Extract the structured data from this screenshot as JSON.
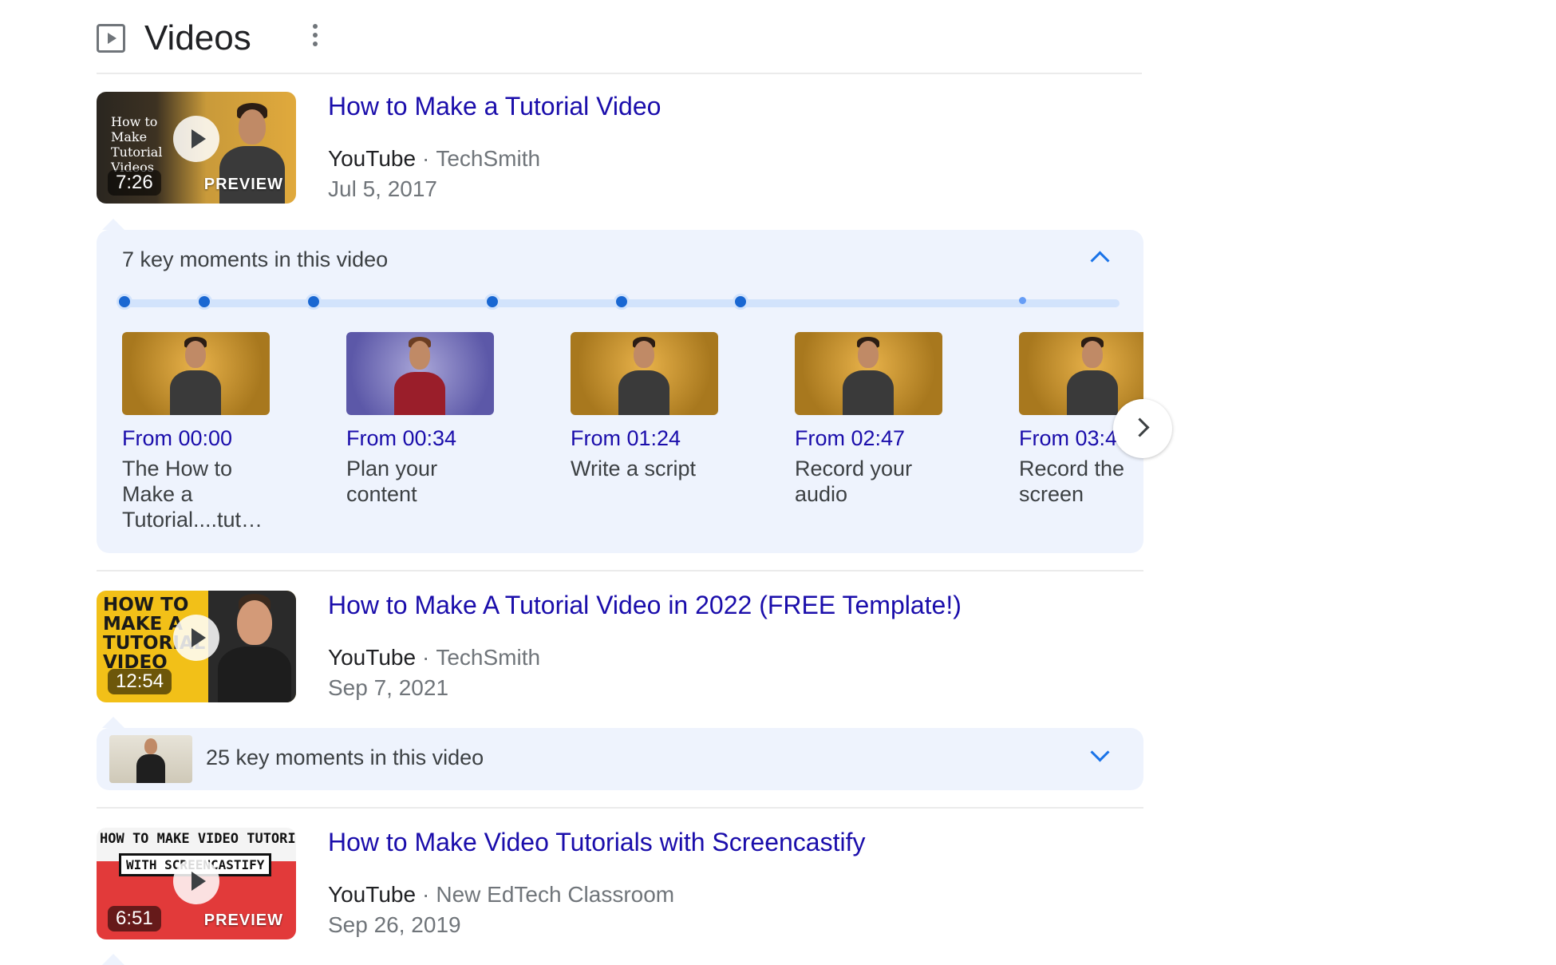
{
  "header": {
    "title": "Videos"
  },
  "results": [
    {
      "title": "How to Make a Tutorial Video",
      "source": "YouTube",
      "channel": "TechSmith",
      "date": "Jul 5, 2017",
      "duration": "7:26",
      "preview": "PREVIEW",
      "thumb_text": "How to Make Tutorial Videos"
    },
    {
      "title": "How to Make A Tutorial Video in 2022 (FREE Template!)",
      "source": "YouTube",
      "channel": "TechSmith",
      "date": "Sep 7, 2021",
      "duration": "12:54",
      "thumb_text": "HOW TO MAKE A TUTORIAL VIDEO"
    },
    {
      "title": "How to Make Video Tutorials with Screencastify",
      "source": "YouTube",
      "channel": "New EdTech Classroom",
      "date": "Sep 26, 2019",
      "duration": "6:51",
      "preview": "PREVIEW",
      "thumb_text": "HOW TO MAKE VIDEO TUTORIALS",
      "thumb_text2": "WITH SCREENCASTIFY"
    }
  ],
  "key_moments_1": {
    "heading": "7 key moments in this video",
    "moments": [
      {
        "time": "From 00:00",
        "label": "The How to Make a Tutorial....tut…"
      },
      {
        "time": "From 00:34",
        "label": "Plan your content"
      },
      {
        "time": "From 01:24",
        "label": "Write a script"
      },
      {
        "time": "From 02:47",
        "label": "Record your audio"
      },
      {
        "time": "From 03:4",
        "label": "Record the screen"
      }
    ]
  },
  "key_moments_2": {
    "heading": "25 key moments in this video"
  },
  "icons": {
    "header": "video-play-icon",
    "menu": "more-vert-icon",
    "collapse": "chevron-up-icon",
    "expand": "chevron-down-icon",
    "next": "chevron-right-icon"
  },
  "colors": {
    "link": "#1a0dab",
    "accent": "#1a73e8",
    "panel": "#eef3fd"
  }
}
